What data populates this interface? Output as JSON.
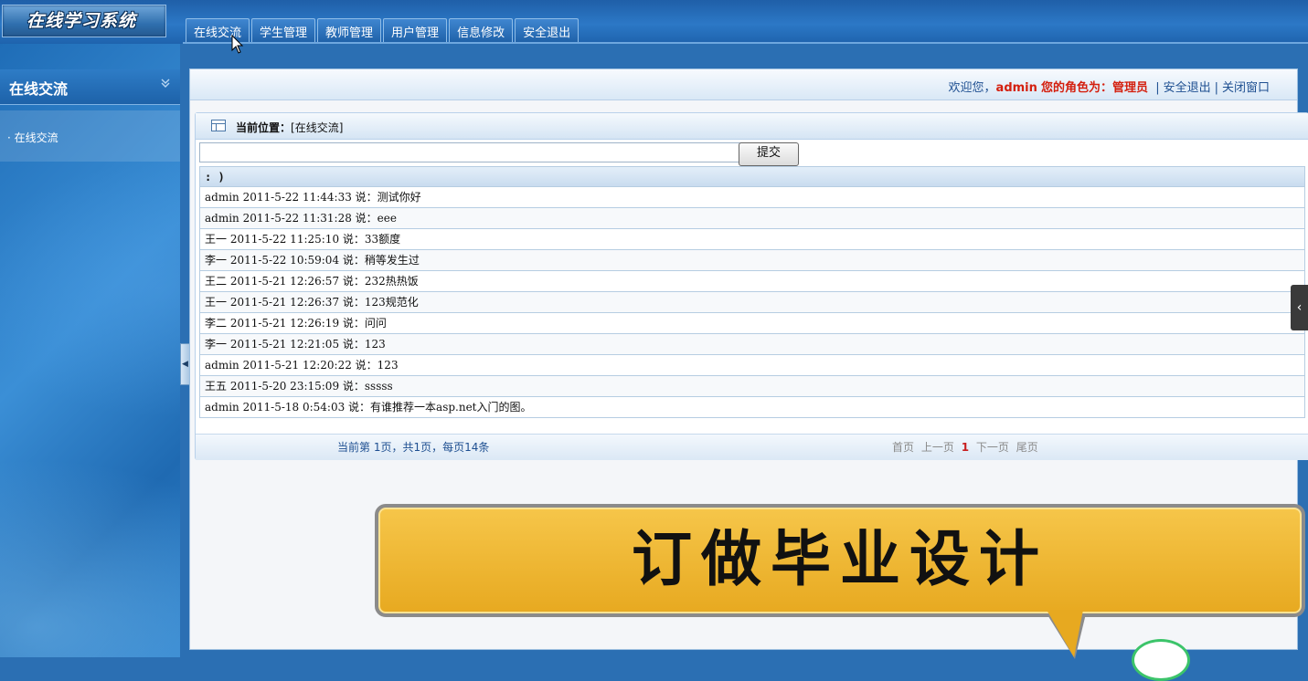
{
  "header": {
    "logo_text": "在线学习系统",
    "nav_tabs": [
      "在线交流",
      "学生管理",
      "教师管理",
      "用户管理",
      "信息修改",
      "安全退出"
    ]
  },
  "sidebar": {
    "title": "在线交流",
    "items": [
      {
        "label": "在线交流"
      }
    ]
  },
  "topinfo": {
    "welcome_prefix": "欢迎您，",
    "username": "admin",
    "role_label": "您的角色为：管理员",
    "logout": "安全退出",
    "close": "关闭窗口"
  },
  "panel": {
    "crumb_label": "当前位置：",
    "crumb_value": "[在线交流]",
    "input_value": "",
    "submit_label": "提交",
    "header_text": ": )",
    "messages": [
      "admin 2011-5-22 11:44:33 说：测试你好",
      "admin 2011-5-22 11:31:28 说：eee",
      "王一  2011-5-22 11:25:10 说：33额度",
      "李一  2011-5-22 10:59:04 说：稍等发生过",
      "王二  2011-5-21 12:26:57 说：232热热饭",
      "王一  2011-5-21 12:26:37 说：123规范化",
      "李二  2011-5-21 12:26:19 说：问问",
      "李一  2011-5-21 12:21:05 说：123",
      "admin 2011-5-21 12:20:22 说：123",
      "王五  2011-5-20 23:15:09 说：sssss",
      "admin 2011-5-18 0:54:03 说：有谁推荐一本asp.net入门的图。"
    ],
    "pager_info": "当前第 1页，共1页，每页14条",
    "pager_first": "首页",
    "pager_prev": "上一页",
    "pager_current": "1",
    "pager_next": "下一页",
    "pager_last": "尾页"
  },
  "banner": {
    "text": "订做毕业设计"
  },
  "icons": {
    "side_chevron": "double-chevron-down-icon",
    "crumb": "table-icon",
    "right_handle": "chevron-left-icon",
    "split_handle": "triangle-left-icon"
  },
  "colors": {
    "accent_red": "#d4200f",
    "link_blue": "#1e4f91",
    "banner_yellow": "#f0b830"
  }
}
